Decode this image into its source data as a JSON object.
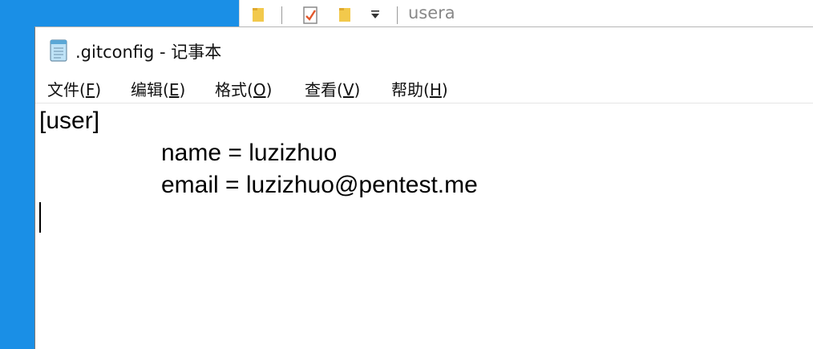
{
  "background_window": {
    "path_text": "usera",
    "icons": [
      "folder-icon",
      "properties-check-icon",
      "new-folder-icon",
      "dropdown-arrow-icon"
    ]
  },
  "notepad": {
    "title": ".gitconfig - 记事本",
    "menu": [
      {
        "label": "文件(",
        "accel": "F",
        "tail": ")"
      },
      {
        "label": "编辑(",
        "accel": "E",
        "tail": ")"
      },
      {
        "label": "格式(",
        "accel": "O",
        "tail": ")"
      },
      {
        "label": "查看(",
        "accel": "V",
        "tail": ")"
      },
      {
        "label": "帮助(",
        "accel": "H",
        "tail": ")"
      }
    ],
    "content": {
      "line1": "[user]",
      "line2": "name = luzizhuo",
      "line3": "email = luzizhuo@pentest.me"
    }
  },
  "colors": {
    "desktop": "#1a8fe6",
    "window": "#ffffff",
    "text": "#000000"
  }
}
